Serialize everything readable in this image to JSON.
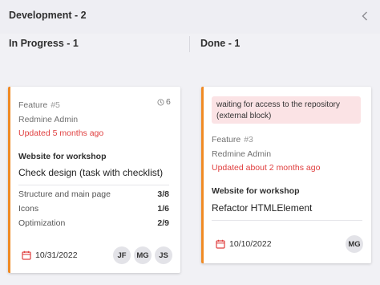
{
  "group": {
    "title": "Development - 2"
  },
  "columns": [
    {
      "title": "In Progress - 1"
    },
    {
      "title": "Done - 1"
    }
  ],
  "cards": [
    {
      "type": "Feature",
      "id": "#5",
      "comment_count": "6",
      "author": "Redmine Admin",
      "updated": "Updated 5 months ago",
      "project": "Website for workshop",
      "subject": "Check design (task with checklist)",
      "checklist": [
        {
          "label": "Structure and main page",
          "count": "3/8"
        },
        {
          "label": "Icons",
          "count": "1/6"
        },
        {
          "label": "Optimization",
          "count": "2/9"
        }
      ],
      "due_date": "10/31/2022",
      "assignees": [
        "JF",
        "MG",
        "JS"
      ]
    },
    {
      "blocked_note": "waiting for access to the repository (external block)",
      "type": "Feature",
      "id": "#3",
      "author": "Redmine Admin",
      "updated": "Updated about 2 months ago",
      "project": "Website for workshop",
      "subject": "Refactor HTMLElement",
      "due_date": "10/10/2022",
      "assignees": [
        "MG"
      ]
    }
  ],
  "colors": {
    "accent": "#f08a24",
    "overdue": "#e04040",
    "blocked_bg": "#fbe3e5"
  }
}
